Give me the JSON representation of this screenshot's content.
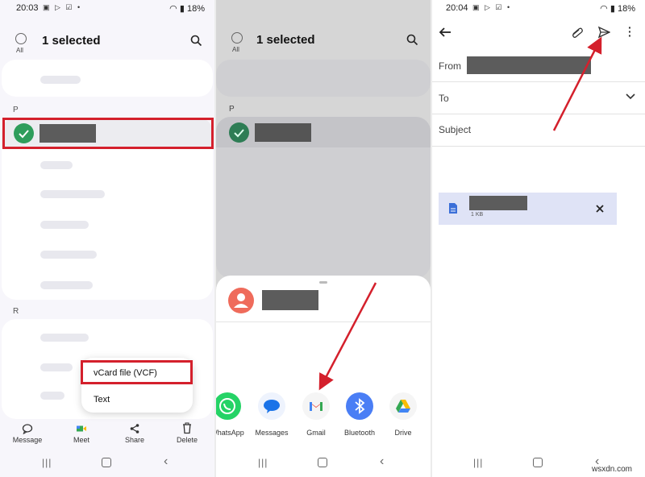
{
  "panel1": {
    "status": {
      "time": "20:03",
      "battery": "18%"
    },
    "header": {
      "all_label": "All",
      "title": "1 selected"
    },
    "section_p": "P",
    "section_r": "R",
    "popup": {
      "vcf_label": "vCard file (VCF)",
      "text_label": "Text"
    },
    "bottom_bar": [
      {
        "label": "Message",
        "icon": "message-icon"
      },
      {
        "label": "Meet",
        "icon": "meet-icon"
      },
      {
        "label": "Share",
        "icon": "share-icon"
      },
      {
        "label": "Delete",
        "icon": "trash-icon"
      }
    ]
  },
  "panel2": {
    "header": {
      "all_label": "All",
      "title": "1 selected"
    },
    "section_p": "P",
    "apps": [
      {
        "label": "WhatsApp",
        "icon": "whatsapp-icon",
        "color": "#25d366"
      },
      {
        "label": "Messages",
        "icon": "messages-icon",
        "color": "#1a73e8"
      },
      {
        "label": "Gmail",
        "icon": "gmail-icon",
        "color": "#ea4335"
      },
      {
        "label": "Bluetooth",
        "icon": "bluetooth-icon",
        "color": "#4a7ef5"
      },
      {
        "label": "Drive",
        "icon": "drive-icon",
        "color": "#34a853"
      }
    ]
  },
  "panel3": {
    "status": {
      "time": "20:04",
      "battery": "18%"
    },
    "from_label": "From",
    "to_label": "To",
    "subject_label": "Subject",
    "attachment_size": "1 KB"
  },
  "colors": {
    "accent_green": "#2e9d5b",
    "highlight_red": "#d4202c",
    "attachment_bg": "#dfe3f6"
  },
  "watermark": "wsxdn.com"
}
